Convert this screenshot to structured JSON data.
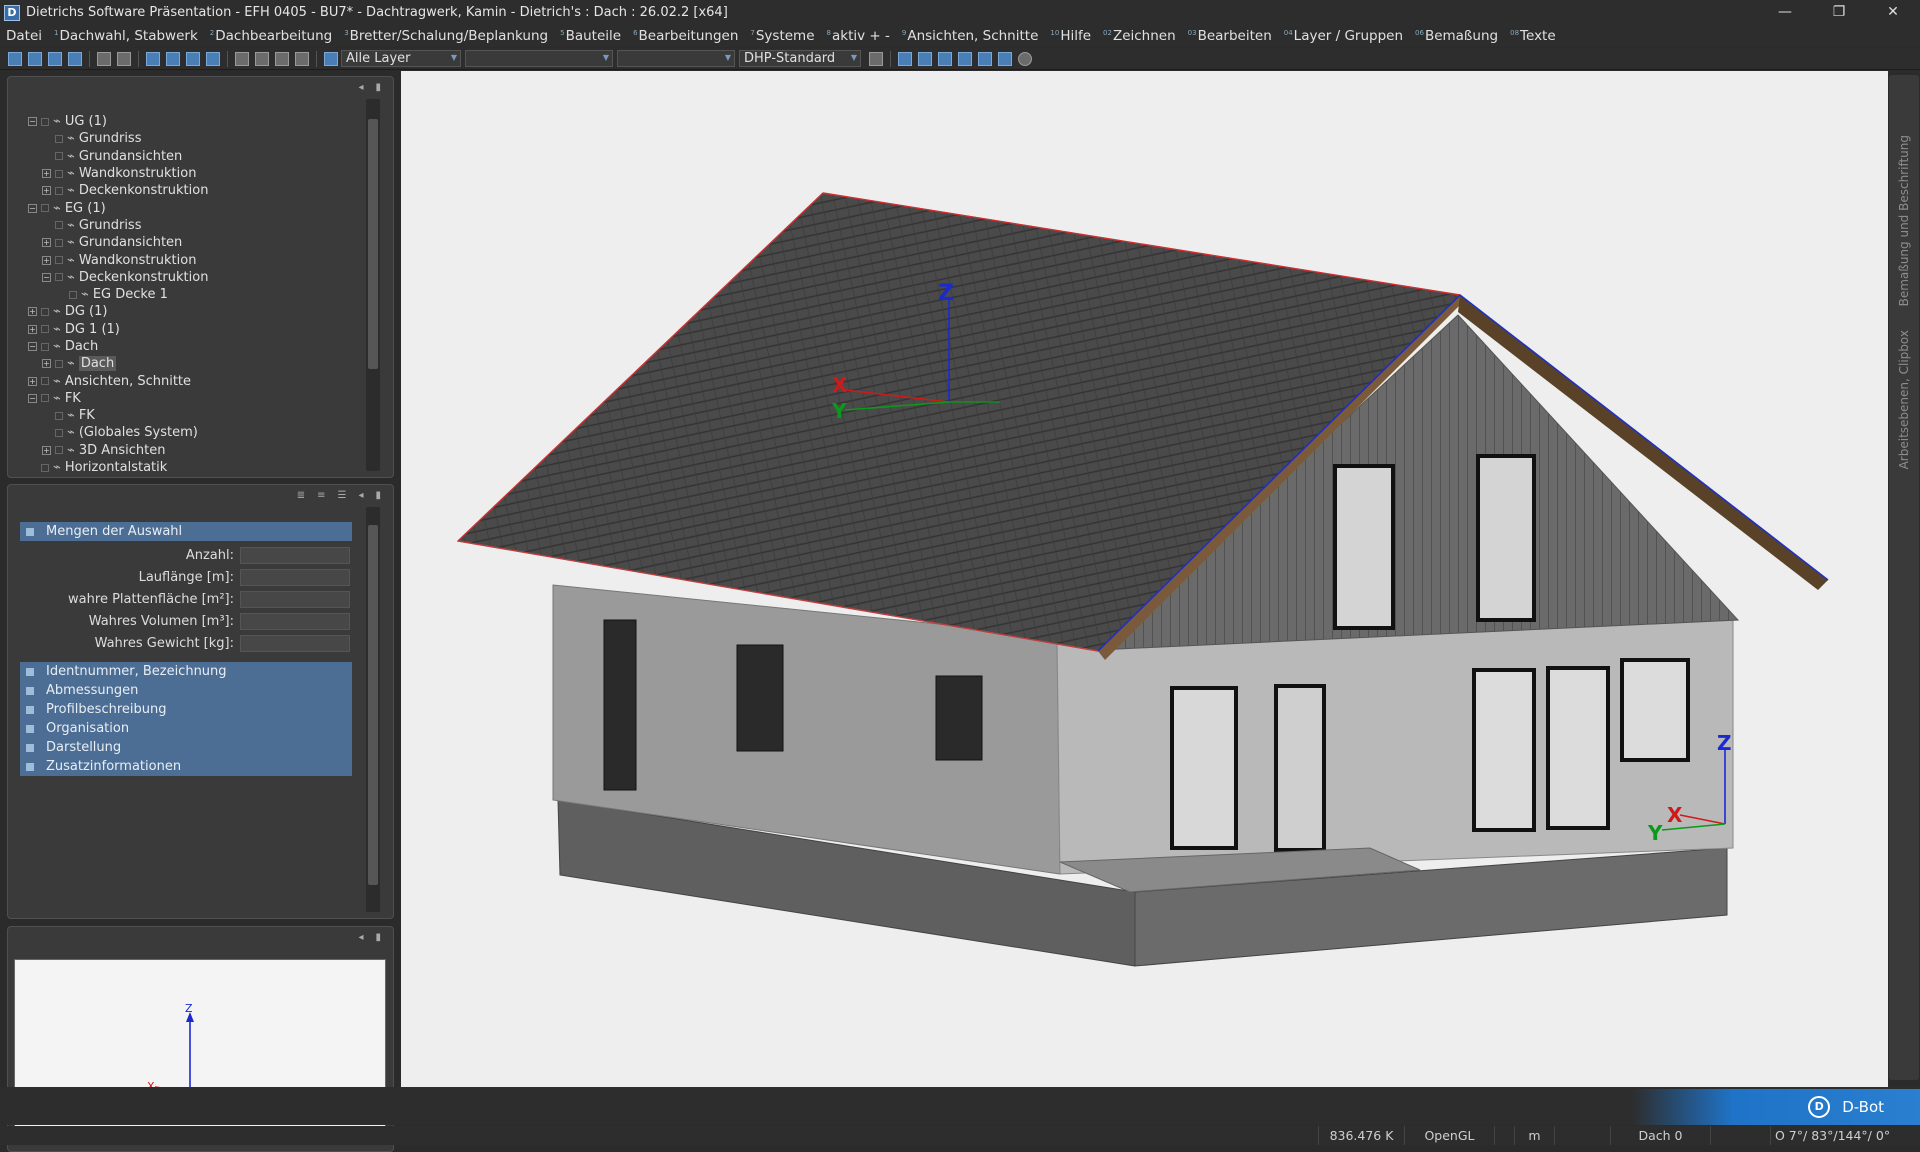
{
  "window": {
    "title": "Dietrichs Software Präsentation - EFH 0405 - BU7* - Dachtragwerk, Kamin  - Dietrich's : Dach : 26.02.2 [x64]",
    "icon": "D",
    "controls": {
      "minimize": "—",
      "restore": "❐",
      "close": "✕"
    }
  },
  "menu": [
    {
      "sup": "",
      "label": "Datei"
    },
    {
      "sup": "1",
      "label": "Dachwahl, Stabwerk"
    },
    {
      "sup": "2",
      "label": "Dachbearbeitung"
    },
    {
      "sup": "3",
      "label": "Bretter/Schalung/Beplankung"
    },
    {
      "sup": "5",
      "label": "Bauteile"
    },
    {
      "sup": "6",
      "label": "Bearbeitungen"
    },
    {
      "sup": "7",
      "label": "Systeme"
    },
    {
      "sup": "8",
      "label": "aktiv + -"
    },
    {
      "sup": "9",
      "label": "Ansichten, Schnitte"
    },
    {
      "sup": "10",
      "label": "Hilfe"
    },
    {
      "sup": "02",
      "label": "Zeichnen"
    },
    {
      "sup": "03",
      "label": "Bearbeiten"
    },
    {
      "sup": "04",
      "label": "Layer / Gruppen"
    },
    {
      "sup": "06",
      "label": "Bemaßung"
    },
    {
      "sup": "08",
      "label": "Texte"
    }
  ],
  "toolbar": {
    "layer_combo": "Alle Layer",
    "style_combo": "DHP-Standard"
  },
  "tree": [
    {
      "level": 0,
      "expander": "−",
      "label": "UG (1)"
    },
    {
      "level": 1,
      "expander": "",
      "label": "Grundriss"
    },
    {
      "level": 1,
      "expander": "",
      "label": "Grundansichten"
    },
    {
      "level": 1,
      "expander": "+",
      "label": "Wandkonstruktion"
    },
    {
      "level": 1,
      "expander": "+",
      "label": "Deckenkonstruktion"
    },
    {
      "level": 0,
      "expander": "−",
      "label": "EG (1)"
    },
    {
      "level": 1,
      "expander": "",
      "label": "Grundriss"
    },
    {
      "level": 1,
      "expander": "+",
      "label": "Grundansichten"
    },
    {
      "level": 1,
      "expander": "+",
      "label": "Wandkonstruktion"
    },
    {
      "level": 1,
      "expander": "−",
      "label": "Deckenkonstruktion"
    },
    {
      "level": 2,
      "expander": "",
      "label": "EG Decke 1"
    },
    {
      "level": 0,
      "expander": "+",
      "label": "DG (1)"
    },
    {
      "level": 0,
      "expander": "+",
      "label": "DG 1 (1)"
    },
    {
      "level": 0,
      "expander": "−",
      "label": "Dach"
    },
    {
      "level": 1,
      "expander": "+",
      "label": "Dach",
      "selected": true
    },
    {
      "level": 0,
      "expander": "+",
      "label": "Ansichten, Schnitte"
    },
    {
      "level": 0,
      "expander": "−",
      "label": "FK"
    },
    {
      "level": 1,
      "expander": "",
      "label": "FK"
    },
    {
      "level": 1,
      "expander": "",
      "label": "(Globales System)"
    },
    {
      "level": 1,
      "expander": "+",
      "label": "3D Ansichten"
    },
    {
      "level": 0,
      "expander": "",
      "label": "Horizontalstatik"
    }
  ],
  "props": {
    "header": "Mengen der Auswahl",
    "fields": [
      {
        "label": "Anzahl:",
        "value": ""
      },
      {
        "label": "Lauflänge [m]:",
        "value": ""
      },
      {
        "label": "wahre Plattenfläche [m²]:",
        "value": ""
      },
      {
        "label": "Wahres Volumen [m³]:",
        "value": ""
      },
      {
        "label": "Wahres Gewicht [kg]:",
        "value": ""
      }
    ],
    "sections": [
      "Identnummer, Bezeichnung",
      "Abmessungen",
      "Profilbeschreibung",
      "Organisation",
      "Darstellung",
      "Zusatzinformationen"
    ]
  },
  "axes": {
    "x": "X",
    "y": "Y",
    "z": "Z"
  },
  "side_tabs": [
    "Bemaßung und Beschriftung",
    "Arbeitsebenen, Clipbox"
  ],
  "dbot": {
    "label": "D-Bot"
  },
  "status": {
    "coord": "836.476 K",
    "renderer": "OpenGL",
    "unit": "m",
    "layer": "Dach 0",
    "angles": "O  7°/ 83°/144°/  0°"
  },
  "colors": {
    "panel": "#3a3a3a",
    "section_blue": "#4c6e94",
    "viewport": "#eeeeee",
    "accent": "#2a7fd0"
  }
}
